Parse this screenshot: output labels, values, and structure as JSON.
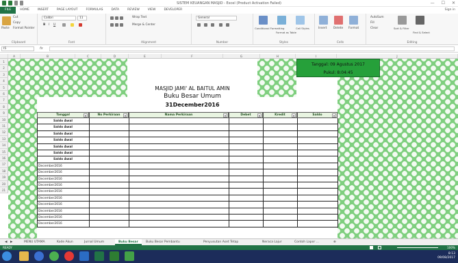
{
  "window": {
    "title": "SISTEM KEUANGAN MASJID - Excel (Product Activation Failed)",
    "min": "—",
    "max": "☐",
    "close": "✕"
  },
  "ribbon_tabs": [
    "FILE",
    "HOME",
    "INSERT",
    "PAGE LAYOUT",
    "FORMULAS",
    "DATA",
    "REVIEW",
    "VIEW",
    "DEVELOPER"
  ],
  "sign_in": "Sign in",
  "ribbon": {
    "clipboard": {
      "paste": "Paste",
      "cut": "Cut",
      "copy": "Copy",
      "format_painter": "Format Painter",
      "label": "Clipboard"
    },
    "font": {
      "name": "Calibri",
      "size": "11",
      "bold": "B",
      "italic": "I",
      "underline": "U",
      "label": "Font"
    },
    "alignment": {
      "wrap": "Wrap Text",
      "merge": "Merge & Center",
      "label": "Alignment"
    },
    "number": {
      "format": "General",
      "label": "Number"
    },
    "styles": {
      "conditional": "Conditional Formatting",
      "table": "Format as Table",
      "cell": "Cell Styles",
      "label": "Styles"
    },
    "cells": {
      "insert": "Insert",
      "delete": "Delete",
      "format": "Format",
      "label": "Cells"
    },
    "editing": {
      "autosum": "AutoSum",
      "fill": "Fill",
      "clear": "Clear",
      "sort": "Sort & Filter",
      "find": "Find & Select",
      "label": "Editing"
    }
  },
  "formula_bar": {
    "name_box": "I5",
    "fx": "fx",
    "content": ""
  },
  "columns": [
    "A",
    "B",
    "C",
    "D",
    "E",
    "F",
    "G",
    "H",
    "I",
    "J"
  ],
  "sheet": {
    "title1": "MASJID JAMI' AL BAITUL AMIN",
    "title2": "Buku Besar Umum",
    "title3": "31December2016",
    "date_text": "Tanggal: 09 Agustus 2017",
    "time_text": "Pukul: 8:04:45",
    "headers": [
      "Tanggal",
      "No Perkiraan",
      "Nama Perkiraan",
      "Debet",
      "Kredit",
      "Saldo"
    ],
    "rows": [
      {
        "row": "5",
        "tanggal": "Saldo Awal"
      },
      {
        "row": "6",
        "tanggal": "Saldo Awal"
      },
      {
        "row": "7",
        "tanggal": "Saldo Awal"
      },
      {
        "row": "8",
        "tanggal": "Saldo Awal"
      },
      {
        "row": "9",
        "tanggal": "Saldo Awal"
      },
      {
        "row": "10",
        "tanggal": "Saldo Awal"
      },
      {
        "row": "11",
        "tanggal": "Saldo Awal"
      },
      {
        "row": "12",
        "tanggal": "December2016"
      },
      {
        "row": "13",
        "tanggal": "December2016"
      },
      {
        "row": "14",
        "tanggal": "December2016"
      },
      {
        "row": "15",
        "tanggal": "December2016"
      },
      {
        "row": "16",
        "tanggal": "December2016"
      },
      {
        "row": "17",
        "tanggal": "December2016"
      },
      {
        "row": "18",
        "tanggal": "December2016"
      },
      {
        "row": "19",
        "tanggal": "December2016"
      },
      {
        "row": "20",
        "tanggal": "December2016"
      },
      {
        "row": "21",
        "tanggal": "December2016"
      }
    ],
    "top_rows": [
      "1",
      "2",
      "3",
      "4"
    ]
  },
  "sheet_tabs": [
    "MENU UTAMA",
    "Kode Akun",
    "Jurnal Umum",
    "Buku Besar",
    "Buku Besar Pembantu",
    "Penyusutan Aset Tetap",
    "Neraca Lajur",
    "Contoh Lapor ..."
  ],
  "active_sheet": "Buku Besar",
  "status": {
    "ready": "READY",
    "zoom": "100%"
  },
  "taskbar": {
    "time": "8:13",
    "date": "09/08/2017"
  },
  "colors": {
    "excel_green": "#217346",
    "pattern_green": "#7fcf7f",
    "header_fill": "#e8f4e1",
    "taskbar": "#1c2c5a"
  }
}
